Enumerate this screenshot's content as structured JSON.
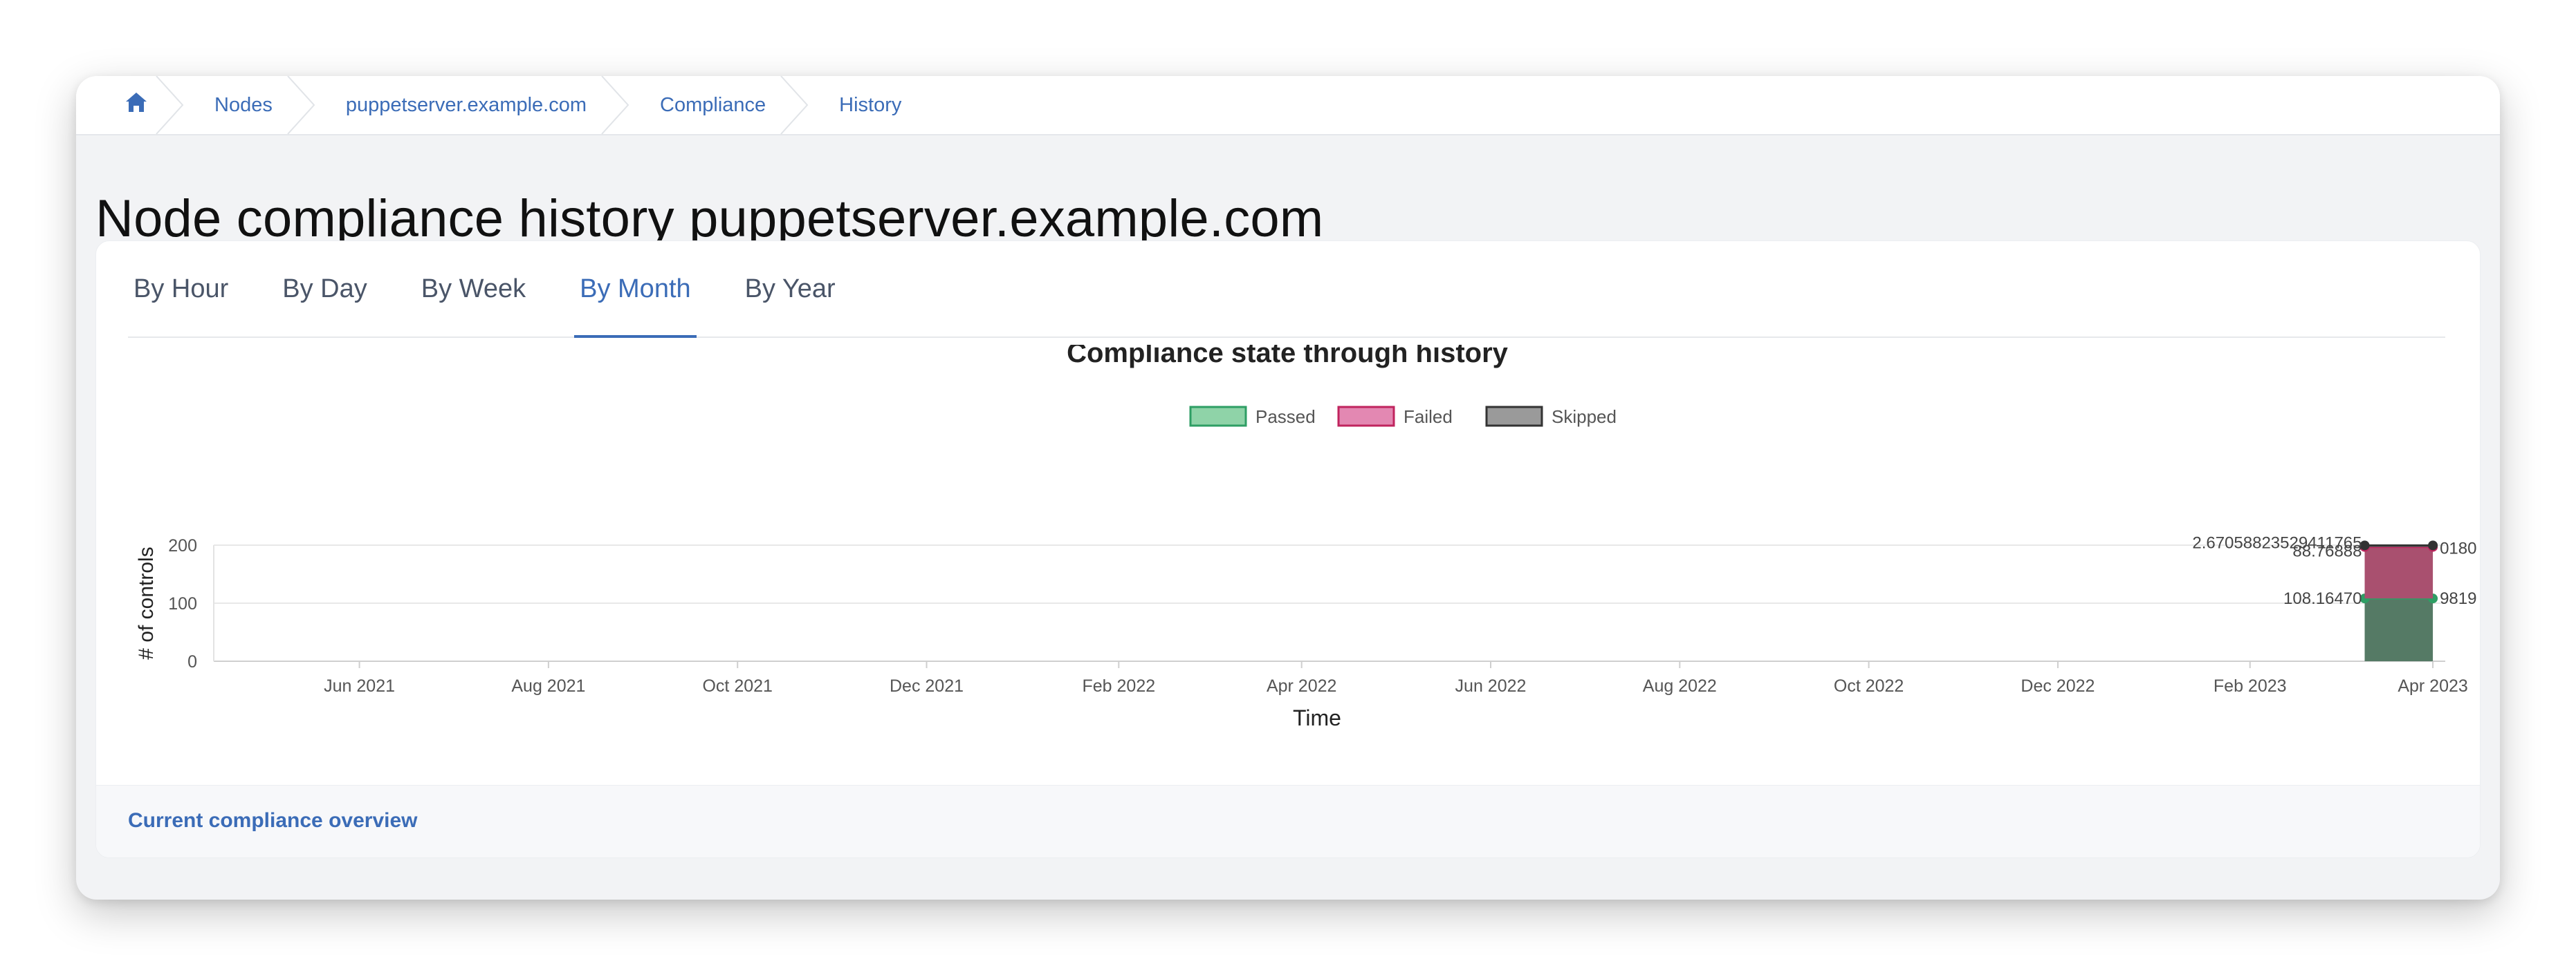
{
  "breadcrumb": {
    "home_icon": "home-icon",
    "items": [
      {
        "label": "Nodes"
      },
      {
        "label": "puppetserver.example.com"
      },
      {
        "label": "Compliance"
      },
      {
        "label": "History"
      }
    ]
  },
  "page": {
    "title": "Node compliance history puppetserver.example.com"
  },
  "tabs": [
    {
      "label": "By Hour",
      "active": false
    },
    {
      "label": "By Day",
      "active": false
    },
    {
      "label": "By Week",
      "active": false
    },
    {
      "label": "By Month",
      "active": true
    },
    {
      "label": "By Year",
      "active": false
    }
  ],
  "footer": {
    "link_label": "Current compliance overview"
  },
  "colors": {
    "accent": "#3b6cb7",
    "passed_fill": "#557a65",
    "passed_legend": "#8fd3a8",
    "passed_border": "#2e9e64",
    "failed_fill": "#a9506f",
    "failed_legend": "#e388b2",
    "failed_border": "#c0245e",
    "skipped_fill": "#6b6b6b",
    "skipped_legend": "#9a9a9a",
    "skipped_border": "#333333"
  },
  "chart_data": {
    "type": "area",
    "stacked": true,
    "title": "Compliance state through history",
    "xlabel": "Time",
    "ylabel": "# of controls",
    "ylim": [
      0,
      200
    ],
    "yticks": [
      "0",
      "100",
      "200"
    ],
    "xticks": [
      "Jun 2021",
      "Aug 2021",
      "Oct 2021",
      "Dec 2021",
      "Feb 2022",
      "Apr 2022",
      "Jun 2022",
      "Aug 2022",
      "Oct 2022",
      "Dec 2022",
      "Feb 2023",
      "Apr 2023"
    ],
    "xrange": [
      "2021-04-15",
      "2023-04-05"
    ],
    "x": [
      "2023-03-10",
      "2023-04-01"
    ],
    "legend_position": "top",
    "grid": true,
    "series": [
      {
        "name": "Passed",
        "values": [
          108.16,
          108.16
        ],
        "labels": [
          "108.16470",
          "9819"
        ]
      },
      {
        "name": "Failed",
        "values": [
          88.77,
          88.77
        ],
        "labels": [
          "88.76888",
          "0180"
        ]
      },
      {
        "name": "Skipped",
        "values": [
          2.67,
          2.67
        ],
        "labels": [
          "2.67058823529411765",
          ""
        ]
      }
    ]
  }
}
